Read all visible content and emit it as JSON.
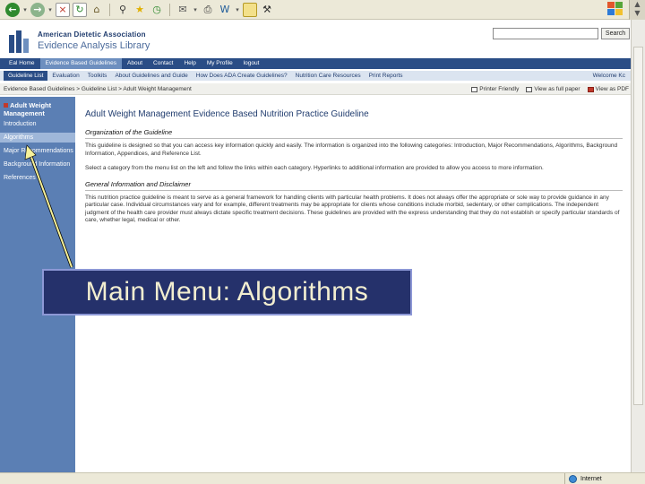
{
  "browser": {
    "status_zone": "Internet"
  },
  "site": {
    "org_name": "American Dietetic Association",
    "library_name": "Evidence Analysis Library",
    "search_button": "Search",
    "search_placeholder": ""
  },
  "nav_primary": [
    "Eal Home",
    "Evidence Based Guidelines",
    "About",
    "Contact",
    "Help",
    "My Profile",
    "logout"
  ],
  "nav_secondary": {
    "items": [
      "Guideline List",
      "Evaluation",
      "Toolkits",
      "About Guidelines and Guide",
      "How Does ADA Create Guidelines?",
      "Nutrition Care Resources",
      "Print Reports"
    ],
    "welcome": "Welcome Kc"
  },
  "breadcrumb": {
    "path": "Evidence Based Guidelines > Guideline List > Adult Weight Management",
    "actions": [
      "Printer Friendly",
      "View as full paper",
      "View as PDF"
    ]
  },
  "sidebar": {
    "heading": "Adult Weight Management",
    "items": [
      "Introduction",
      "Algorithms",
      "Major Recommendations",
      "Background Information",
      "References"
    ]
  },
  "content": {
    "title": "Adult Weight Management Evidence Based Nutrition Practice Guideline",
    "section1_heading": "Organization of the Guideline",
    "section1_p1": "This guideline is designed so that you can access key information quickly and easily. The information is organized into the following categories: Introduction, Major Recommendations, Algorithms, Background Information, Appendices, and Reference List.",
    "section1_p2": "Select a category from the menu list on the left and follow the links within each category. Hyperlinks to additional information are provided to allow you access to more information.",
    "section2_heading": "General Information and Disclaimer",
    "section2_p1": "This nutrition practice guideline is meant to serve as a general framework for handling clients with particular health problems. It does not always offer the appropriate or sole way to provide guidance in any particular case. Individual circumstances vary and for example, different treatments may be appropriate for clients whose conditions include morbid, sedentary, or other complications. The independent judgment of the health care provider must always dictate specific treatment decisions. These guidelines are provided with the express understanding that they do not establish or specify particular standards of care, whether legal, medical or other."
  },
  "callout": {
    "text": "Main Menu: Algorithms"
  }
}
